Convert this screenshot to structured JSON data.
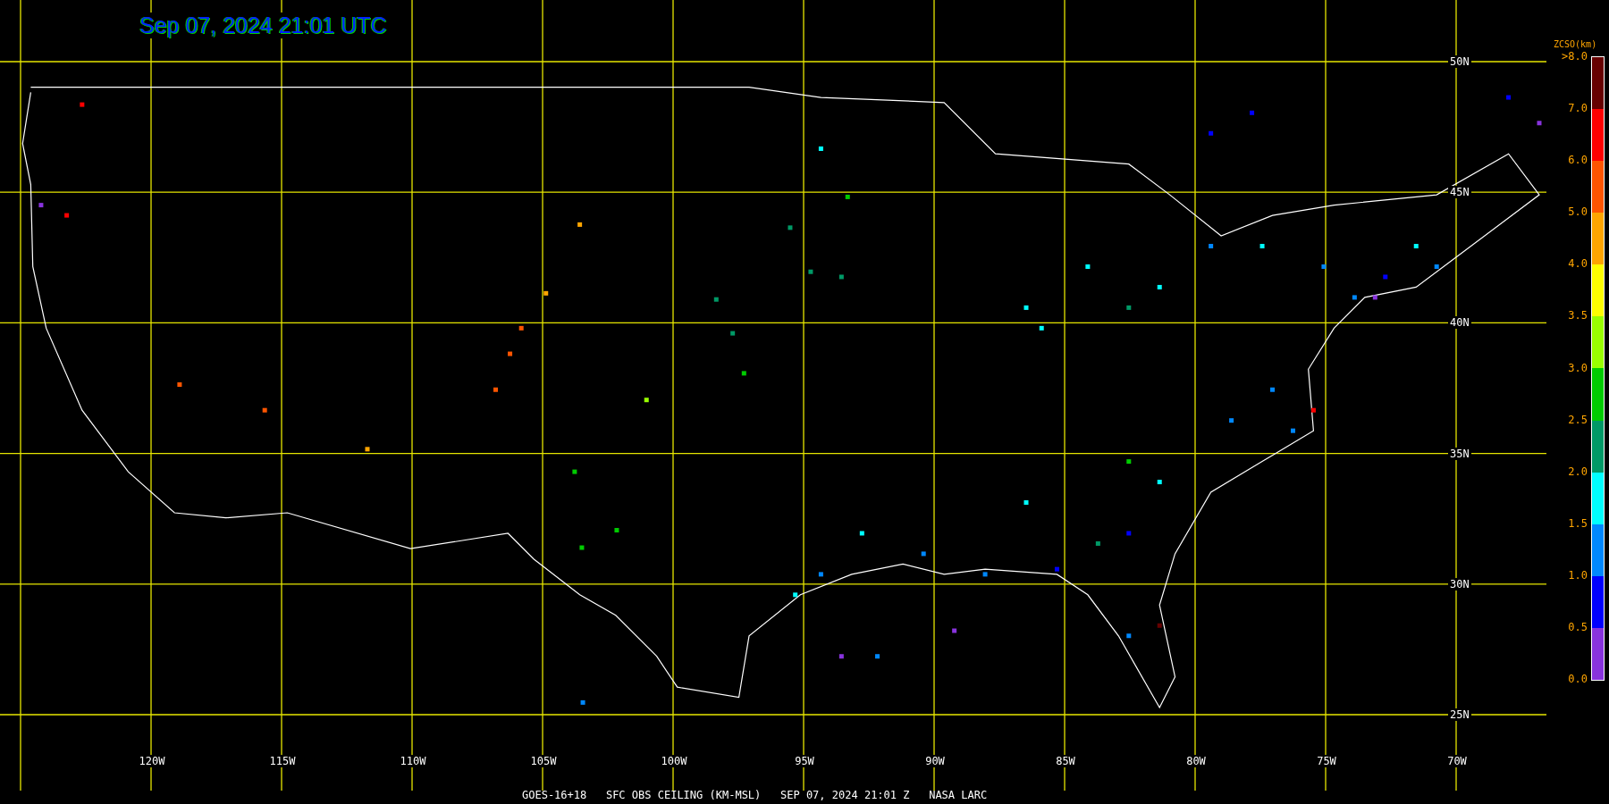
{
  "title": "Sep 07, 2024 21:01 UTC",
  "latitude_labels": [
    "50N",
    "45N",
    "40N",
    "35N",
    "30N",
    "25N"
  ],
  "longitude_labels": [
    "120W",
    "115W",
    "110W",
    "105W",
    "100W",
    "95W",
    "90W",
    "85W",
    "80W",
    "75W",
    "70W"
  ],
  "legend": {
    "title": "ZCSO(km)",
    "labels": [
      ">8.0",
      "7.0",
      "6.0",
      "5.0",
      "4.0",
      "3.5",
      "3.0",
      "2.5",
      "2.0",
      "1.5",
      "1.0",
      "0.5",
      "0.0"
    ],
    "bins": [
      {
        "color": "#660000"
      },
      {
        "color": "#ff0000"
      },
      {
        "color": "#ff5500"
      },
      {
        "color": "#ffa500"
      },
      {
        "color": "#ffff00"
      },
      {
        "color": "#99ff00"
      },
      {
        "color": "#00cc00"
      },
      {
        "color": "#009966"
      },
      {
        "color": "#00ffff"
      },
      {
        "color": "#0088ff"
      },
      {
        "color": "#0000ff"
      },
      {
        "color": "#8833dd"
      }
    ]
  },
  "caption": "GOES-16+18   SFC OBS CEILING (KM-MSL)   SEP 07, 2024 21:01 Z   NASA LARC"
}
